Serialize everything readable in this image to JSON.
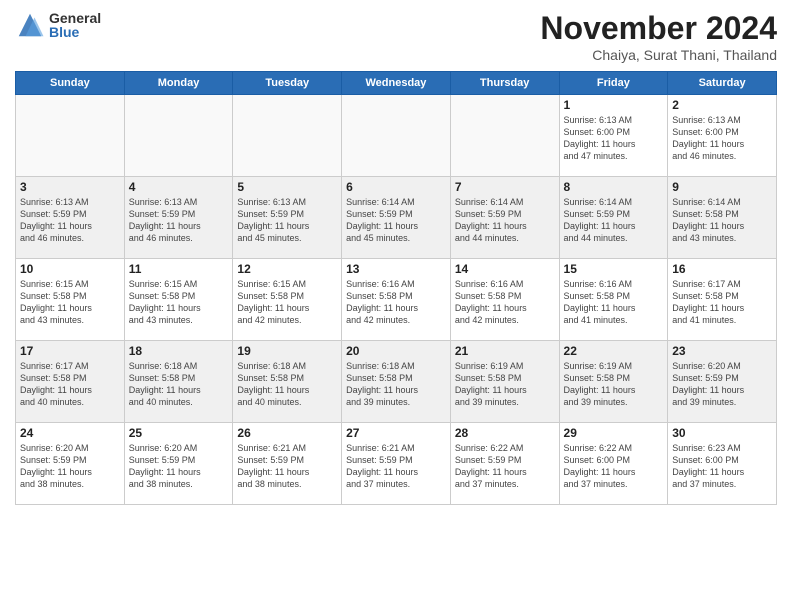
{
  "logo": {
    "general": "General",
    "blue": "Blue"
  },
  "header": {
    "month_title": "November 2024",
    "location": "Chaiya, Surat Thani, Thailand"
  },
  "days_of_week": [
    "Sunday",
    "Monday",
    "Tuesday",
    "Wednesday",
    "Thursday",
    "Friday",
    "Saturday"
  ],
  "weeks": [
    [
      {
        "day": "",
        "info": "",
        "empty": true
      },
      {
        "day": "",
        "info": "",
        "empty": true
      },
      {
        "day": "",
        "info": "",
        "empty": true
      },
      {
        "day": "",
        "info": "",
        "empty": true
      },
      {
        "day": "",
        "info": "",
        "empty": true
      },
      {
        "day": "1",
        "info": "Sunrise: 6:13 AM\nSunset: 6:00 PM\nDaylight: 11 hours\nand 47 minutes."
      },
      {
        "day": "2",
        "info": "Sunrise: 6:13 AM\nSunset: 6:00 PM\nDaylight: 11 hours\nand 46 minutes."
      }
    ],
    [
      {
        "day": "3",
        "info": "Sunrise: 6:13 AM\nSunset: 5:59 PM\nDaylight: 11 hours\nand 46 minutes.",
        "shaded": true
      },
      {
        "day": "4",
        "info": "Sunrise: 6:13 AM\nSunset: 5:59 PM\nDaylight: 11 hours\nand 46 minutes.",
        "shaded": true
      },
      {
        "day": "5",
        "info": "Sunrise: 6:13 AM\nSunset: 5:59 PM\nDaylight: 11 hours\nand 45 minutes.",
        "shaded": true
      },
      {
        "day": "6",
        "info": "Sunrise: 6:14 AM\nSunset: 5:59 PM\nDaylight: 11 hours\nand 45 minutes.",
        "shaded": true
      },
      {
        "day": "7",
        "info": "Sunrise: 6:14 AM\nSunset: 5:59 PM\nDaylight: 11 hours\nand 44 minutes.",
        "shaded": true
      },
      {
        "day": "8",
        "info": "Sunrise: 6:14 AM\nSunset: 5:59 PM\nDaylight: 11 hours\nand 44 minutes.",
        "shaded": true
      },
      {
        "day": "9",
        "info": "Sunrise: 6:14 AM\nSunset: 5:58 PM\nDaylight: 11 hours\nand 43 minutes.",
        "shaded": true
      }
    ],
    [
      {
        "day": "10",
        "info": "Sunrise: 6:15 AM\nSunset: 5:58 PM\nDaylight: 11 hours\nand 43 minutes."
      },
      {
        "day": "11",
        "info": "Sunrise: 6:15 AM\nSunset: 5:58 PM\nDaylight: 11 hours\nand 43 minutes."
      },
      {
        "day": "12",
        "info": "Sunrise: 6:15 AM\nSunset: 5:58 PM\nDaylight: 11 hours\nand 42 minutes."
      },
      {
        "day": "13",
        "info": "Sunrise: 6:16 AM\nSunset: 5:58 PM\nDaylight: 11 hours\nand 42 minutes."
      },
      {
        "day": "14",
        "info": "Sunrise: 6:16 AM\nSunset: 5:58 PM\nDaylight: 11 hours\nand 42 minutes."
      },
      {
        "day": "15",
        "info": "Sunrise: 6:16 AM\nSunset: 5:58 PM\nDaylight: 11 hours\nand 41 minutes."
      },
      {
        "day": "16",
        "info": "Sunrise: 6:17 AM\nSunset: 5:58 PM\nDaylight: 11 hours\nand 41 minutes."
      }
    ],
    [
      {
        "day": "17",
        "info": "Sunrise: 6:17 AM\nSunset: 5:58 PM\nDaylight: 11 hours\nand 40 minutes.",
        "shaded": true
      },
      {
        "day": "18",
        "info": "Sunrise: 6:18 AM\nSunset: 5:58 PM\nDaylight: 11 hours\nand 40 minutes.",
        "shaded": true
      },
      {
        "day": "19",
        "info": "Sunrise: 6:18 AM\nSunset: 5:58 PM\nDaylight: 11 hours\nand 40 minutes.",
        "shaded": true
      },
      {
        "day": "20",
        "info": "Sunrise: 6:18 AM\nSunset: 5:58 PM\nDaylight: 11 hours\nand 39 minutes.",
        "shaded": true
      },
      {
        "day": "21",
        "info": "Sunrise: 6:19 AM\nSunset: 5:58 PM\nDaylight: 11 hours\nand 39 minutes.",
        "shaded": true
      },
      {
        "day": "22",
        "info": "Sunrise: 6:19 AM\nSunset: 5:58 PM\nDaylight: 11 hours\nand 39 minutes.",
        "shaded": true
      },
      {
        "day": "23",
        "info": "Sunrise: 6:20 AM\nSunset: 5:59 PM\nDaylight: 11 hours\nand 39 minutes.",
        "shaded": true
      }
    ],
    [
      {
        "day": "24",
        "info": "Sunrise: 6:20 AM\nSunset: 5:59 PM\nDaylight: 11 hours\nand 38 minutes."
      },
      {
        "day": "25",
        "info": "Sunrise: 6:20 AM\nSunset: 5:59 PM\nDaylight: 11 hours\nand 38 minutes."
      },
      {
        "day": "26",
        "info": "Sunrise: 6:21 AM\nSunset: 5:59 PM\nDaylight: 11 hours\nand 38 minutes."
      },
      {
        "day": "27",
        "info": "Sunrise: 6:21 AM\nSunset: 5:59 PM\nDaylight: 11 hours\nand 37 minutes."
      },
      {
        "day": "28",
        "info": "Sunrise: 6:22 AM\nSunset: 5:59 PM\nDaylight: 11 hours\nand 37 minutes."
      },
      {
        "day": "29",
        "info": "Sunrise: 6:22 AM\nSunset: 6:00 PM\nDaylight: 11 hours\nand 37 minutes."
      },
      {
        "day": "30",
        "info": "Sunrise: 6:23 AM\nSunset: 6:00 PM\nDaylight: 11 hours\nand 37 minutes."
      }
    ]
  ]
}
